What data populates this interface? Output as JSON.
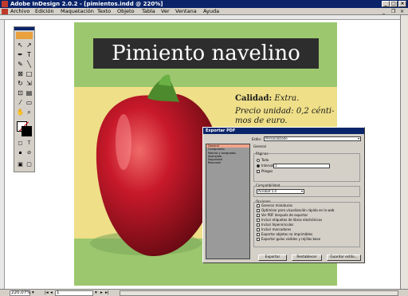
{
  "window": {
    "title": "Adobe InDesign 2.0.2 - [pimientos.indd @ 220%]",
    "controls": [
      "_",
      "□",
      "×"
    ]
  },
  "menubar": {
    "items": [
      "Archivo",
      "Edición",
      "Maquetación",
      "Texto",
      "Objeto",
      "Tabla",
      "Ver",
      "Ventana",
      "Ayuda"
    ]
  },
  "document": {
    "title": "Pimiento navelino",
    "calidad_label": "Calidad:",
    "calidad_value": "Extra.",
    "precio": "Precio unidad: 0,2 cénti-mos de euro."
  },
  "dialog": {
    "title": "Exportar PDF",
    "estilo_label": "Estilo:",
    "estilo_value": "Personalizado",
    "sections": [
      "General",
      "Compresión",
      "Marcas y sangrados",
      "Avanzado",
      "Seguridad",
      "Resumen"
    ],
    "selected_section": "General",
    "panel_title": "General",
    "paginas_group": "Páginas",
    "todo_label": "Todo",
    "intervalo_label": "Intervalo:",
    "intervalo_value": "1",
    "pliegos_label": "Pliegos",
    "compatibilidad_group": "Compatibilidad",
    "compatibilidad_value": "Acrobat 5.0",
    "opciones_group": "Opciones",
    "opciones": [
      "Generar miniaturas",
      "Optimizar para visualización rápida en la web",
      "Ver PDF después de exportar",
      "Incluir etiquetas de libros electrónicos",
      "Incluir hipervínculos",
      "Incluir marcadores",
      "Exportar objetos no imprimibles",
      "Exportar guías visibles y rejillas base"
    ],
    "buttons": {
      "exportar": "Exportar",
      "restablecer": "Restablecer",
      "guardar": "Guardar estilo..."
    }
  },
  "statusbar": {
    "zoom": "220,07%",
    "page": "1"
  },
  "colors": {
    "title_bar": "#0a246a",
    "page_green": "#9cc76e",
    "page_yellow": "#eedf88",
    "pepper_red": "#c8192a",
    "title_box": "#2d2d2d"
  }
}
